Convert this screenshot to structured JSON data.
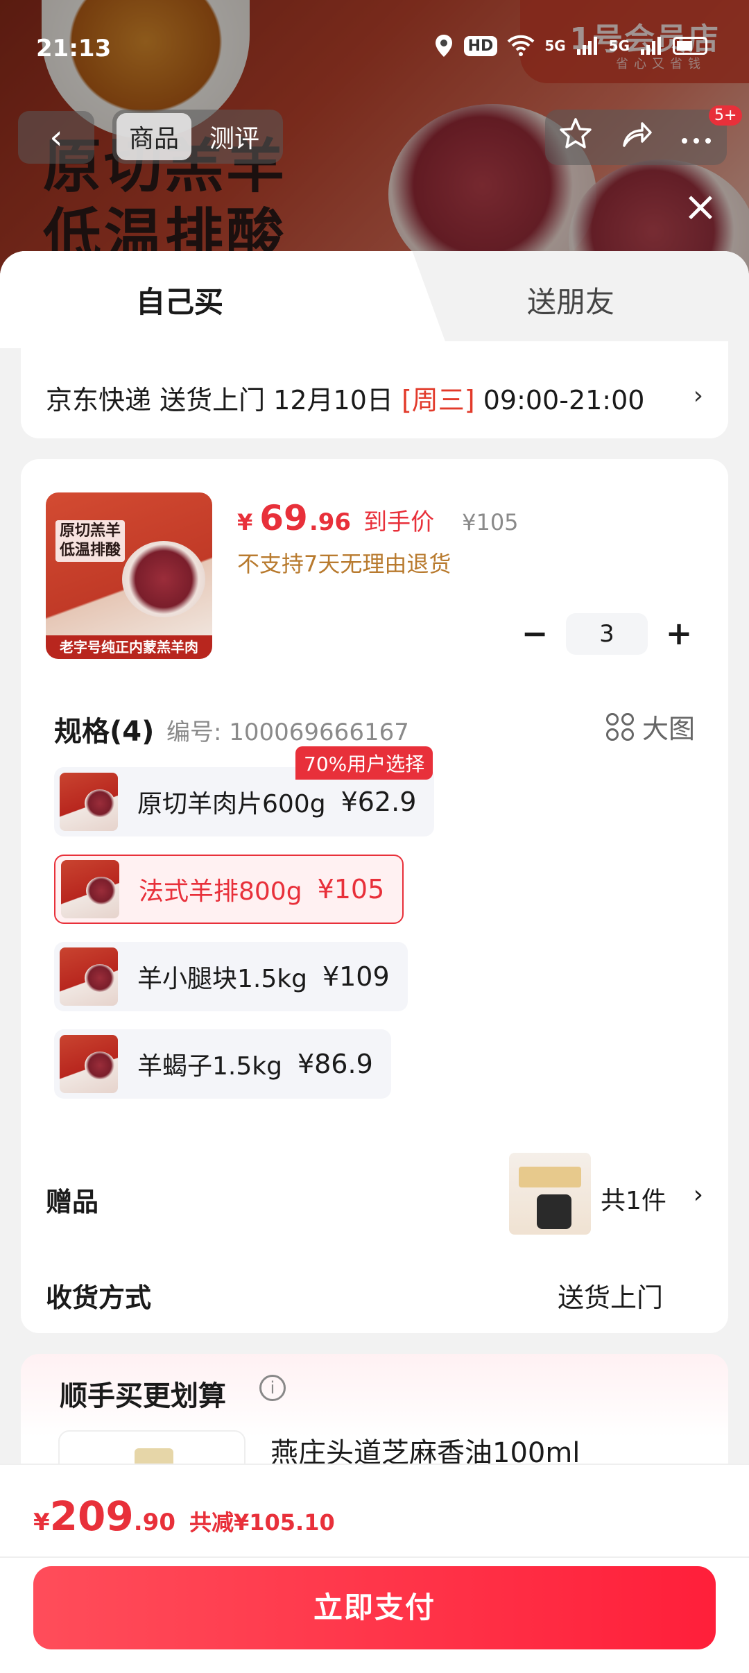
{
  "status_bar": {
    "time": "21:13",
    "hd": "HD",
    "net1": "5G",
    "net2": "5G"
  },
  "background": {
    "title_line1": "原切羔羊",
    "title_line2": "低温排酸",
    "logo": "1号会员店",
    "logo_sub": "省心又省钱"
  },
  "top_nav": {
    "tabs": [
      "商品",
      "测评"
    ],
    "badge": "5+"
  },
  "mode_tabs": {
    "self": "自己买",
    "friend": "送朋友"
  },
  "delivery": {
    "prefix": "京东快递 送货上门 12月10日",
    "weekday": "[周三]",
    "time": "09:00-21:00"
  },
  "product": {
    "thumb_title_1": "原切羔羊",
    "thumb_title_2": "低温排酸",
    "thumb_band": "老字号纯正内蒙羔羊肉",
    "price_currency": "¥",
    "price_int": "69",
    "price_dec": ".96",
    "price_tag": "到手价",
    "orig_price": "¥105",
    "no_return": "不支持7天无理由退货",
    "quantity": "3"
  },
  "spec": {
    "heading": "规格(4)",
    "code": "编号: 100069666167",
    "bigpic": "大图",
    "badge": "70%用户选择",
    "variants": [
      {
        "label": "原切羊肉片600g",
        "price": "¥62.9"
      },
      {
        "label": "法式羊排800g",
        "price": "¥105"
      },
      {
        "label": "羊小腿块1.5kg",
        "price": "¥109"
      },
      {
        "label": "羊蝎子1.5kg",
        "price": "¥86.9"
      }
    ]
  },
  "gift": {
    "label": "赠品",
    "count": "共1件"
  },
  "receive": {
    "label": "收货方式",
    "value": "送货上门"
  },
  "extra": {
    "title": "顺手买更划算",
    "item_name": "燕庄头道芝麻香油100ml"
  },
  "footer": {
    "currency": "¥",
    "total_int": "209",
    "total_dec": ".90",
    "saving": "共减¥105.10",
    "pay": "立即支付"
  },
  "colors": {
    "accent": "#e8303a",
    "warning": "#b87a2e"
  }
}
